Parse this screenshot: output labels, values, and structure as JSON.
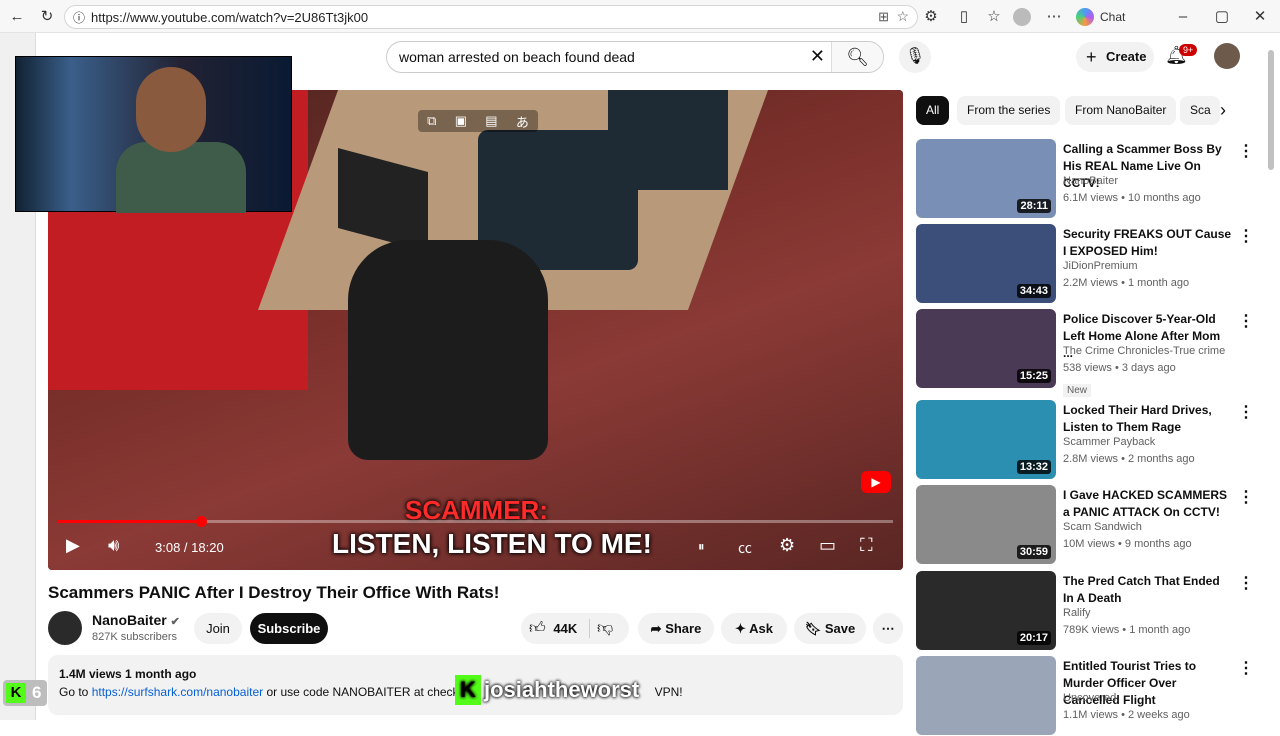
{
  "browser": {
    "url": "https://www.youtube.com/watch?v=2U86Tt3jk00",
    "chat_label": "Chat"
  },
  "search": {
    "query": "woman arrested on beach found dead"
  },
  "header": {
    "create_label": "Create",
    "notif_count": "9+"
  },
  "player": {
    "time": "3:08 / 18:20",
    "progress": 0.171,
    "caption_line1": "SCAMMER:",
    "caption_line2": "LISTEN, LISTEN TO ME!"
  },
  "video": {
    "title": "Scammers PANIC After I Destroy Their Office With Rats!",
    "channel": "NanoBaiter",
    "subscribers": "827K subscribers",
    "join_label": "Join",
    "subscribe_label": "Subscribe",
    "likes": "44K",
    "share_label": "Share",
    "ask_label": "Ask",
    "save_label": "Save",
    "views_date": "1.4M views  1 month ago",
    "desc_prefix": "Go to",
    "desc_link": "https://surfshark.com/nanobaiter",
    "desc_mid": "or use code NANOBAITER at checko",
    "desc_suffix": "VPN!"
  },
  "overlay": {
    "kick_name": "josiahtheworst",
    "kick_count": "6"
  },
  "chips": [
    "All",
    "From the series",
    "From NanoBaiter",
    "Sca"
  ],
  "recommendations": [
    {
      "title": "Calling a Scammer Boss By His REAL Name Live On CCTV!",
      "channel": "NanoBaiter",
      "meta": "6.1M views • 10 months ago",
      "duration": "28:11",
      "color": "#7a8fb5"
    },
    {
      "title": "Security FREAKS OUT Cause I EXPOSED Him!",
      "channel": "JiDionPremium",
      "meta": "2.2M views • 1 month ago",
      "duration": "34:43",
      "color": "#3b4f7a"
    },
    {
      "title": "Police Discover 5-Year-Old Left Home Alone After Mom ...",
      "channel": "The Crime Chronicles-True crime",
      "meta": "538 views • 3 days ago",
      "duration": "15:25",
      "color": "#4a3a55",
      "badge": "New"
    },
    {
      "title": "Locked Their Hard Drives, Listen to Them Rage",
      "channel": "Scammer Payback",
      "meta": "2.8M views • 2 months ago",
      "duration": "13:32",
      "color": "#2a8fb0"
    },
    {
      "title": "I Gave HACKED SCAMMERS a PANIC ATTACK On CCTV!",
      "channel": "Scam Sandwich",
      "meta": "10M views • 9 months ago",
      "duration": "30:59",
      "color": "#8a8a8a"
    },
    {
      "title": "The Pred Catch That Ended In A Death",
      "channel": "Ralify",
      "meta": "789K views • 1 month ago",
      "duration": "20:17",
      "color": "#2a2a2a"
    },
    {
      "title": "Entitled Tourist Tries to Murder Officer Over Cancelled Flight",
      "channel": "Uncovered",
      "meta": "1.1M views • 2 weeks ago",
      "duration": "",
      "color": "#9aa6b8"
    }
  ]
}
